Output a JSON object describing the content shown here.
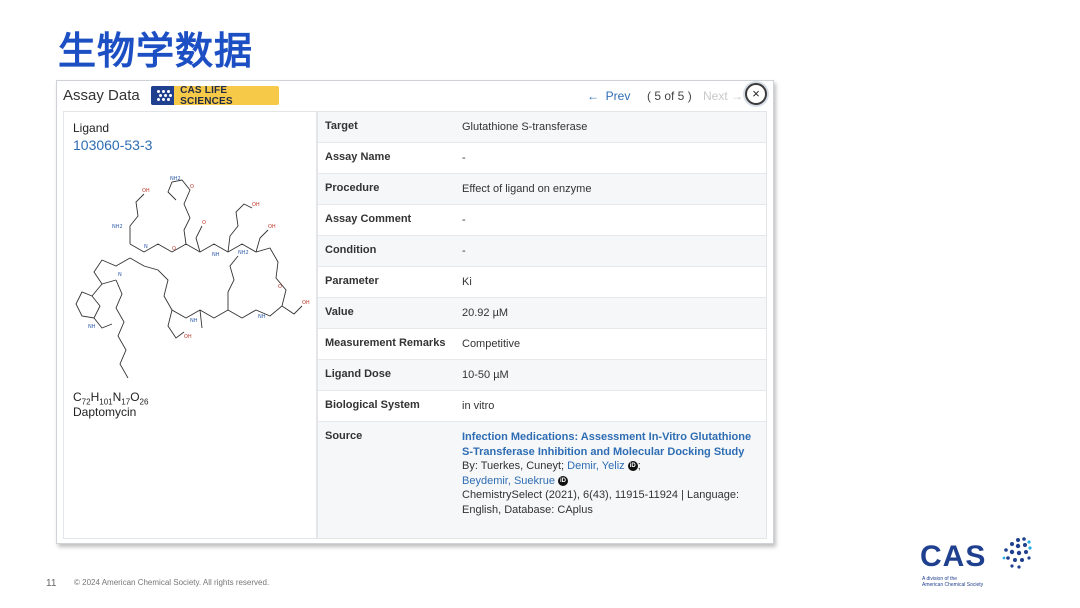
{
  "slide": {
    "title": "生物学数据",
    "page_number": "11",
    "copyright": "© 2024 American Chemical Society. All rights reserved."
  },
  "panel": {
    "title": "Assay Data",
    "badge": "CAS LIFE SCIENCES",
    "nav": {
      "prev_label": "Prev",
      "count": "( 5 of 5 )",
      "next_label": "Next",
      "close_label": "×"
    }
  },
  "ligand": {
    "label": "Ligand",
    "cas_number": "103060-53-3",
    "formula": {
      "C": "72",
      "H": "101",
      "N": "17",
      "O": "26"
    },
    "name": "Daptomycin"
  },
  "assay": {
    "rows": [
      {
        "label": "Target",
        "value": "Glutathione S-transferase"
      },
      {
        "label": "Assay Name",
        "value": "-"
      },
      {
        "label": "Procedure",
        "value": "Effect of ligand on enzyme"
      },
      {
        "label": "Assay Comment",
        "value": "-"
      },
      {
        "label": "Condition",
        "value": "-"
      },
      {
        "label": "Parameter",
        "value": "Ki"
      },
      {
        "label": "Value",
        "value": "20.92 µM"
      },
      {
        "label": "Measurement Remarks",
        "value": "Competitive"
      },
      {
        "label": "Ligand Dose",
        "value": "10-50 µM"
      },
      {
        "label": "Biological System",
        "value": "in vitro"
      }
    ],
    "source": {
      "label": "Source",
      "title": "Infection Medications: Assessment In-Vitro Glutathione S-Transferase Inhibition and Molecular Docking Study",
      "by": "By: Tuerkes, Cuneyt;",
      "author2": "Demir, Yeliz",
      "author3": "Beydemir, Suekrue",
      "citation": "ChemistrySelect (2021), 6(43), 11915-11924 | Language: English, Database: CAplus",
      "orcid": "iD"
    }
  },
  "logo": {
    "text": "CAS",
    "sub1": "A division of the",
    "sub2": "American Chemical Society",
    "color": "#1f3f8f"
  }
}
